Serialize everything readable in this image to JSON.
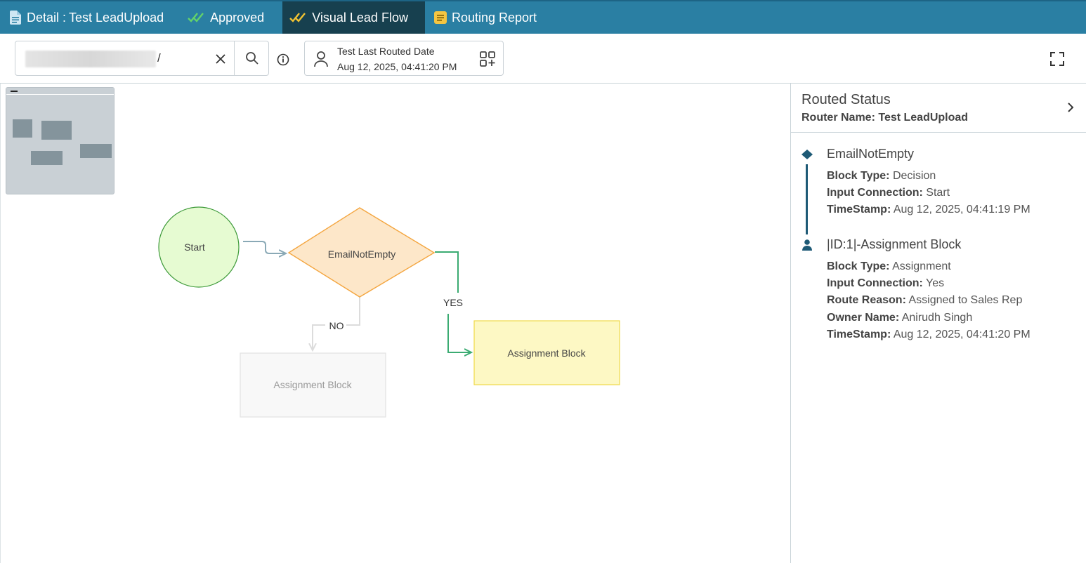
{
  "tabs": [
    {
      "label": "Detail : ",
      "strong": "Test LeadUpload",
      "icon": "document-icon"
    },
    {
      "label": "Approved",
      "icon": "double-check-icon"
    },
    {
      "label": "Visual Lead Flow",
      "icon": "double-check-icon",
      "active": true
    },
    {
      "label": "Routing Report",
      "icon": "report-icon"
    }
  ],
  "toolbar": {
    "search_suffix": "/",
    "routed_title": "Test Last Routed Date",
    "routed_date": "Aug 12, 2025, 04:41:20 PM"
  },
  "flow": {
    "start": "Start",
    "decision": "EmailNotEmpty",
    "yes_label": "YES",
    "no_label": "NO",
    "assignment_yes": "Assignment Block",
    "assignment_no": "Assignment Block"
  },
  "panel": {
    "title": "Routed Status",
    "router_label": "Router Name: Test LeadUpload",
    "entries": [
      {
        "title": "EmailNotEmpty",
        "rows": [
          {
            "k": "Block Type:",
            "v": " Decision"
          },
          {
            "k": "Input Connection:",
            "v": " Start"
          },
          {
            "k": "TimeStamp:",
            "v": " Aug 12, 2025, 04:41:19 PM"
          }
        ]
      },
      {
        "title": "|ID:1|-Assignment Block",
        "rows": [
          {
            "k": "Block Type:",
            "v": " Assignment"
          },
          {
            "k": "Input Connection:",
            "v": " Yes"
          },
          {
            "k": "Route Reason:",
            "v": " Assigned to Sales Rep"
          },
          {
            "k": "Owner Name:",
            "v": " Anirudh Singh"
          },
          {
            "k": "TimeStamp:",
            "v": " Aug 12, 2025, 04:41:20 PM"
          }
        ]
      }
    ]
  },
  "colors": {
    "header_bg": "#2a7fa3",
    "active_tab_bg": "#17404f",
    "start_fill": "#e6fbd2",
    "decision_fill": "#fde7c9",
    "assignment_active_fill": "#fdf8c4",
    "yes_path": "#3bab72",
    "timeline": "#1e5a76"
  }
}
